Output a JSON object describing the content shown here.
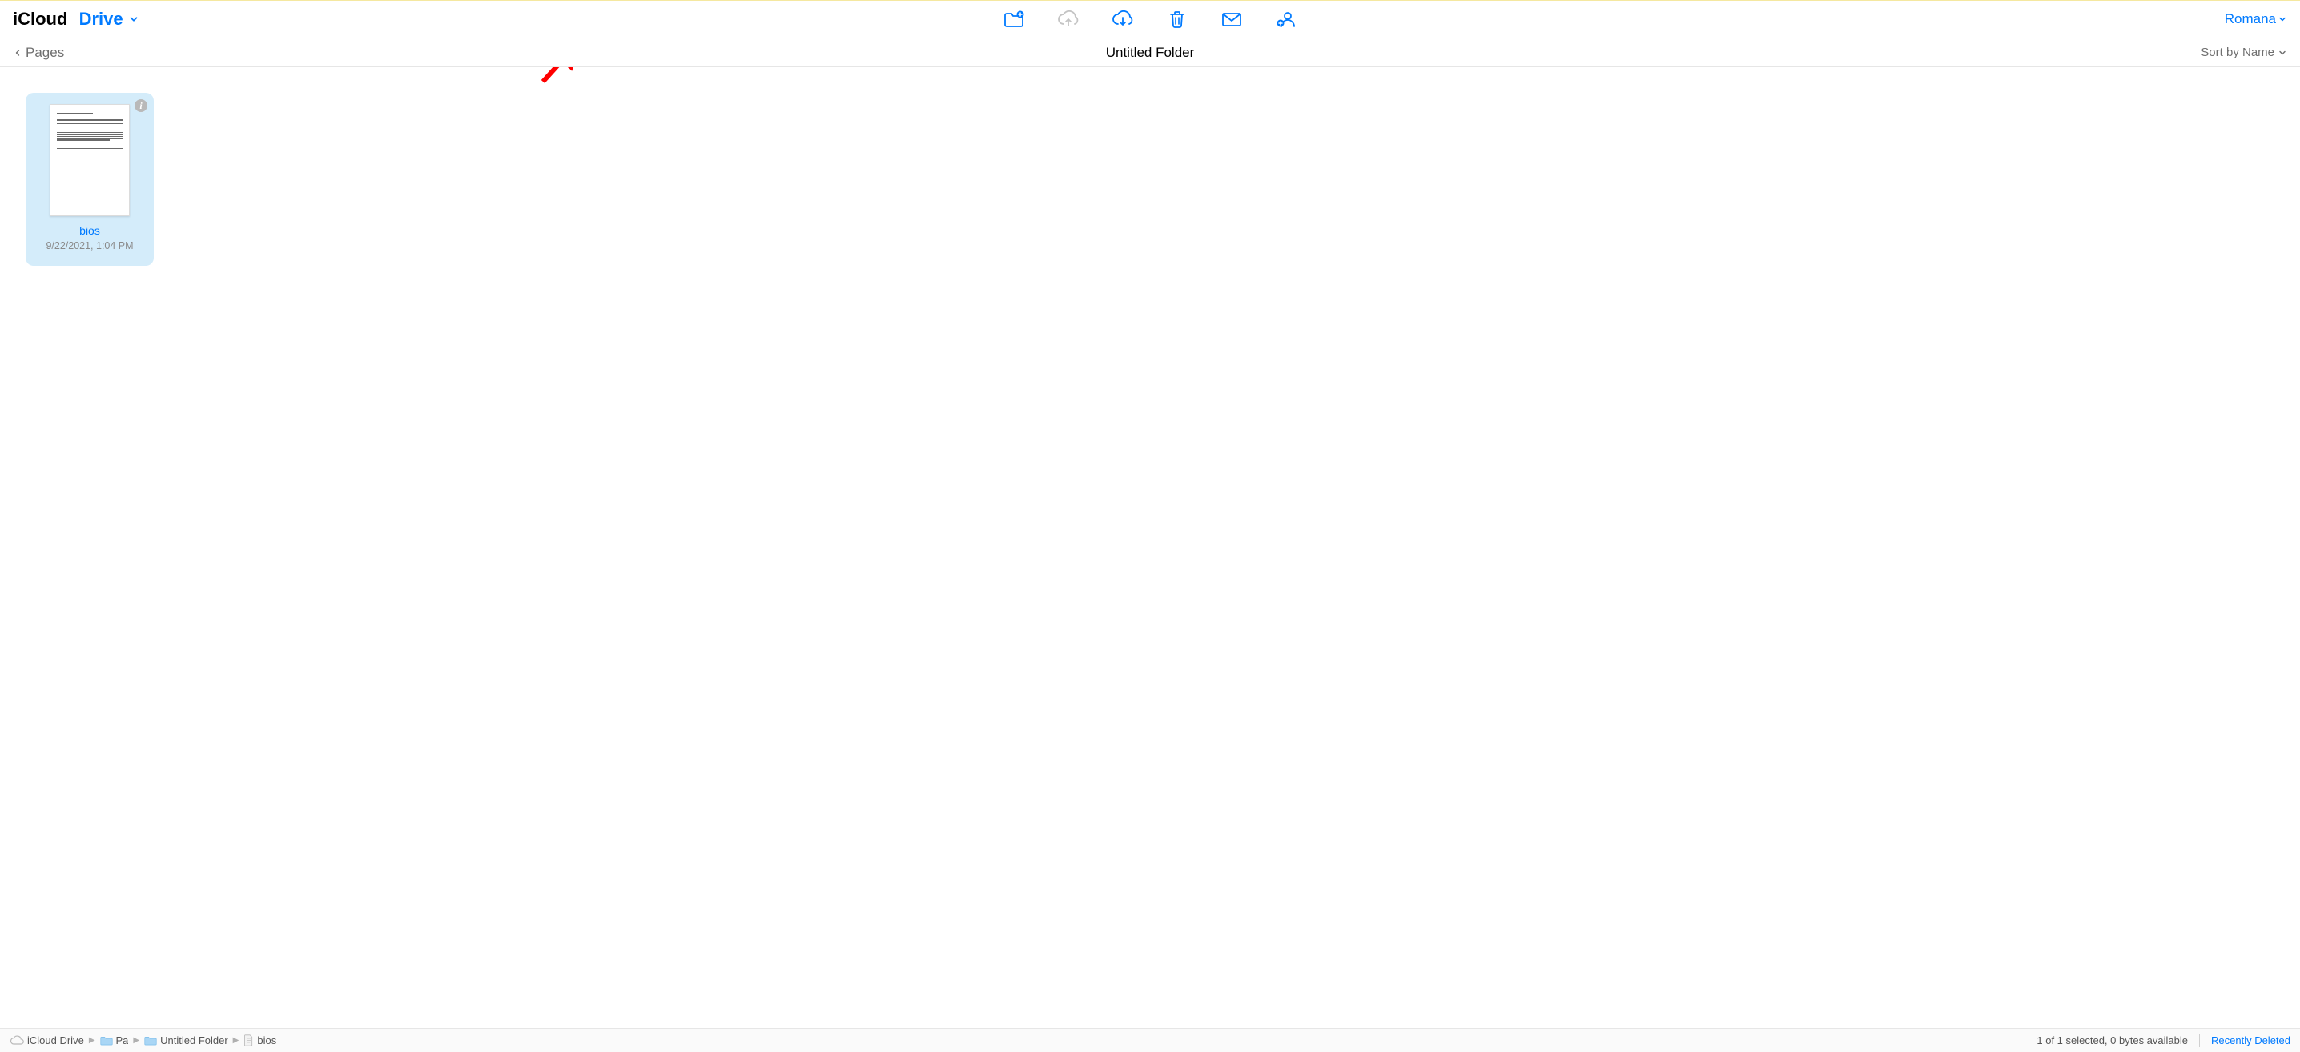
{
  "header": {
    "app_name_black": "iCloud",
    "app_name_blue": "Drive",
    "user_name": "Romana"
  },
  "toolbar": {
    "new_folder": "New Folder",
    "upload": "Upload",
    "download": "Download",
    "delete": "Delete",
    "email": "Email",
    "share": "Share"
  },
  "subheader": {
    "back_label": "Pages",
    "folder_title": "Untitled Folder",
    "sort_label": "Sort by Name"
  },
  "files": [
    {
      "name": "bios",
      "date": "9/22/2021, 1:04 PM",
      "selected": true
    }
  ],
  "breadcrumbs": [
    {
      "label": "iCloud Drive",
      "icon": "cloud"
    },
    {
      "label": "Pa",
      "icon": "folder"
    },
    {
      "label": "Untitled Folder",
      "icon": "folder"
    },
    {
      "label": "bios",
      "icon": "document"
    }
  ],
  "footer": {
    "status": "1 of 1 selected, 0 bytes available",
    "recently_deleted": "Recently Deleted"
  },
  "colors": {
    "accent": "#007aff",
    "selection": "#d4ecfa",
    "muted": "#8a8a8a"
  }
}
